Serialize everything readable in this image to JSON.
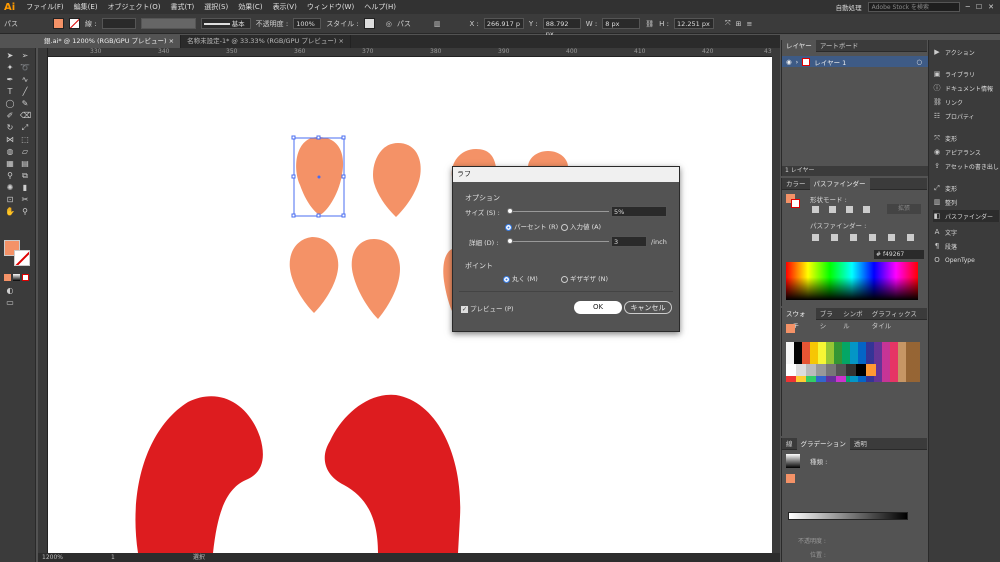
{
  "app": {
    "logo": "Ai"
  },
  "menu": [
    "ファイル(F)",
    "編集(E)",
    "オブジェクト(O)",
    "書式(T)",
    "選択(S)",
    "効果(C)",
    "表示(V)",
    "ウィンドウ(W)",
    "ヘルプ(H)"
  ],
  "workspace": "自動処理",
  "search_placeholder": "Adobe Stock を検索",
  "control": {
    "object_type": "パス",
    "stroke_label": "線 :",
    "brush_label": "基本",
    "opacity_label": "不透明度 :",
    "opacity_value": "100%",
    "style_label": "スタイル :",
    "x_label": "X :",
    "x_value": "266.917 p",
    "y_label": "Y :",
    "y_value": "88.792 px",
    "w_label": "W :",
    "w_value": "8 px",
    "h_label": "H :",
    "h_value": "12.251 px"
  },
  "tabs": [
    {
      "label": "銀.ai* @ 1200% (RGB/GPU プレビュー)"
    },
    {
      "label": "名称未設定-1* @ 33.33% (RGB/GPU プレビュー)"
    }
  ],
  "ruler_ticks": [
    "330",
    "340",
    "350",
    "360",
    "370",
    "380",
    "390",
    "400",
    "410",
    "420",
    "430"
  ],
  "status": {
    "zoom": "1200%",
    "page": "1",
    "tool": "選択"
  },
  "colors": {
    "fill": "#F49267",
    "red": "#DD1C1F",
    "accent": "#3B7EE4"
  },
  "layers": {
    "tab_layers": "レイヤー",
    "tab_artboards": "アートボード",
    "layer_name": "レイヤー 1",
    "layer_count": "1 レイヤー"
  },
  "color_panel": {
    "tabs": [
      "カラー",
      "パスファインダー"
    ],
    "shape_mode": "形状モード :",
    "expand": "拡張",
    "pathfinder": "パスファインダー :",
    "hex_prefix": "#",
    "hex": "f49267"
  },
  "swatches": {
    "tabs": [
      "スウォッチ",
      "ブラシ",
      "シンボル",
      "グラフィックスタイル"
    ]
  },
  "gradient": {
    "tabs": [
      "線",
      "グラデーション",
      "透明"
    ],
    "type_label": "種類 :",
    "opacity_label": "不透明度 :",
    "position_label": "位置 :"
  },
  "dock": [
    {
      "label": "アクション",
      "icon": "play-icon"
    },
    {
      "label": "ライブラリ",
      "icon": "library-icon"
    },
    {
      "label": "ドキュメント情報",
      "icon": "info-icon"
    },
    {
      "label": "リンク",
      "icon": "link-icon"
    },
    {
      "label": "プロパティ",
      "icon": "properties-icon"
    },
    {
      "label": "変形",
      "icon": "transform-icon"
    },
    {
      "label": "アピアランス",
      "icon": "appearance-icon"
    },
    {
      "label": "アセットの書き出し",
      "icon": "export-icon"
    },
    {
      "label": "変形",
      "icon": "transform-icon"
    },
    {
      "label": "整列",
      "icon": "align-icon"
    },
    {
      "label": "パスファインダー",
      "icon": "pathfinder-icon"
    },
    {
      "label": "文字",
      "icon": "type-icon"
    },
    {
      "label": "段落",
      "icon": "paragraph-icon"
    },
    {
      "label": "OpenType",
      "icon": "opentype-icon"
    }
  ],
  "dialog": {
    "title": "ラフ",
    "options_label": "オプション",
    "size_label": "サイズ (S) :",
    "size_value": "5%",
    "percent_label": "パーセント (R)",
    "absolute_label": "入力値 (A)",
    "detail_label": "詳細 (D) :",
    "detail_value": "3",
    "detail_unit": "/inch",
    "points_label": "ポイント",
    "smooth_label": "丸く (M)",
    "corner_label": "ギザギザ (N)",
    "preview_label": "プレビュー (P)",
    "ok": "OK",
    "cancel": "キャンセル"
  }
}
